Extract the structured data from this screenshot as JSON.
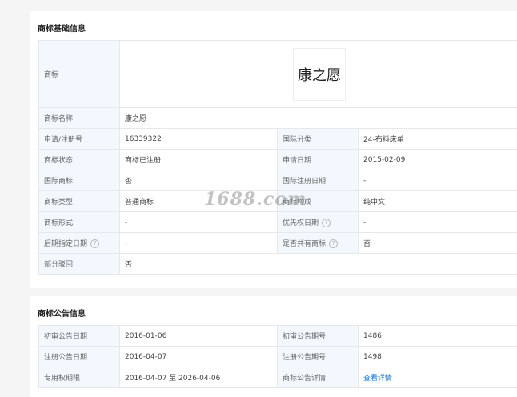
{
  "basic": {
    "title": "商标基础信息",
    "logo_label": "商标",
    "logo_text": "康之愿",
    "rows": [
      {
        "l1": "商标名称",
        "v1": "康之愿",
        "l2": "",
        "v2": ""
      },
      {
        "l1": "申请/注册号",
        "v1": "16339322",
        "l2": "国际分类",
        "v2": "24-布料床单"
      },
      {
        "l1": "商标状态",
        "v1": "商标已注册",
        "l2": "申请日期",
        "v2": "2015-02-09"
      },
      {
        "l1": "国际商标",
        "v1": "否",
        "l2": "国际注册日期",
        "v2": "-"
      },
      {
        "l1": "商标类型",
        "v1": "普通商标",
        "l2": "商标构成",
        "v2": "纯中文"
      },
      {
        "l1": "商标形式",
        "v1": "-",
        "l2": "优先权日期",
        "v2": "-"
      },
      {
        "l1": "后期指定日期",
        "v1": "-",
        "l2": "是否共有商标",
        "v2": "否"
      },
      {
        "l1": "部分驳回",
        "v1": "否"
      }
    ]
  },
  "announce": {
    "title": "商标公告信息",
    "rows": [
      {
        "l1": "初审公告日期",
        "v1": "2016-01-06",
        "l2": "初审公告期号",
        "v2": "1486"
      },
      {
        "l1": "注册公告日期",
        "v1": "2016-04-07",
        "l2": "注册公告期号",
        "v2": "1498"
      },
      {
        "l1": "专用权期限",
        "v1": "2016-04-07 至 2026-04-06",
        "l2": "商标公告详情",
        "v2": "查看详情"
      }
    ]
  },
  "help_glyph": "?",
  "watermark": "1688.com",
  "icons": {
    "help": "question-circle-icon"
  }
}
